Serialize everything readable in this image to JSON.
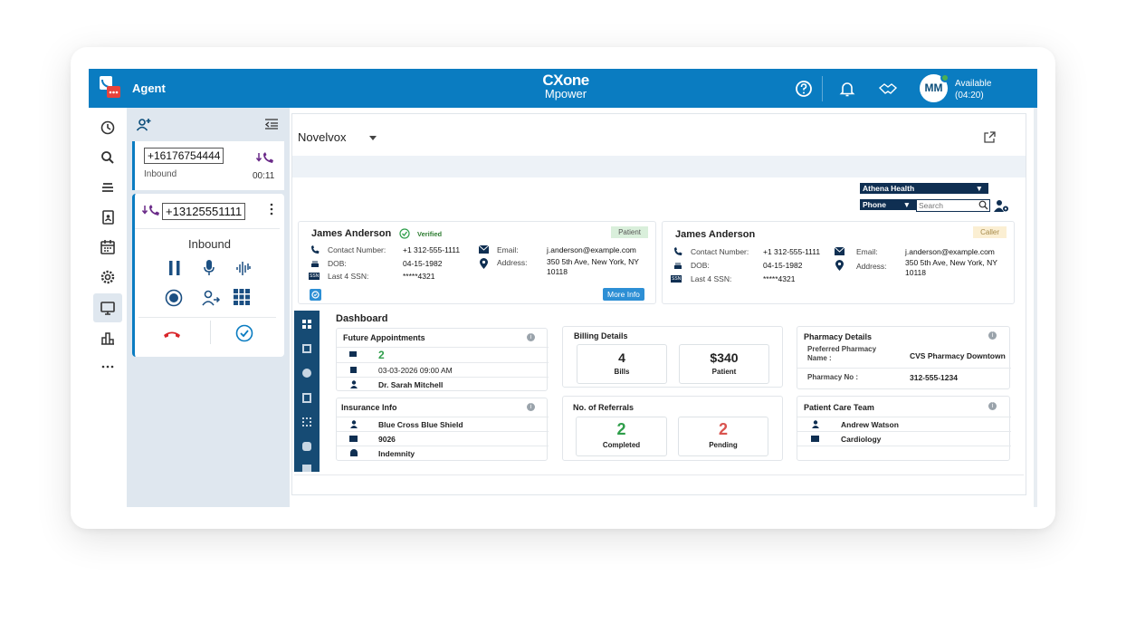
{
  "topbar": {
    "app_label": "Agent",
    "brand_line1": "CXone",
    "brand_line2": "Mpower",
    "avatar_initials": "MM",
    "status": "Available",
    "status_timer": "(04:20)"
  },
  "panel": {
    "call1": {
      "number": "+16176754444",
      "direction": "Inbound",
      "timer": "00:11"
    },
    "call2": {
      "number": "+13125551111",
      "direction": "Inbound"
    }
  },
  "main": {
    "app_select": "Novelvox",
    "ehr_select": "Athena Health",
    "search_type": "Phone",
    "search_placeholder": "Search",
    "patient_card": {
      "name": "James Anderson",
      "verified": "Verified",
      "badge": "Patient",
      "contact_label": "Contact Number:",
      "contact": "+1 312-555-1111",
      "dob_label": "DOB:",
      "dob": "04-15-1982",
      "ssn_label": "Last 4 SSN:",
      "ssn": "*****4321",
      "email_label": "Email:",
      "email": "j.anderson@example.com",
      "address_label": "Address:",
      "address_line1": "350 5th Ave, New York, NY",
      "address_line2": "10118",
      "more_info": "More Info"
    },
    "caller_card": {
      "name": "James Anderson",
      "badge": "Caller",
      "contact_label": "Contact Number:",
      "contact": "+1 312-555-1111",
      "dob_label": "DOB:",
      "dob": "04-15-1982",
      "ssn_label": "Last 4 SSN:",
      "ssn": "*****4321",
      "email_label": "Email:",
      "email": "j.anderson@example.com",
      "address_label": "Address:",
      "address_line1": "350 5th Ave, New York, NY",
      "address_line2": "10118"
    },
    "dashboard": {
      "title": "Dashboard",
      "appointments": {
        "title": "Future Appointments",
        "count": "2",
        "datetime": "03-03-2026 09:00 AM",
        "doctor": "Dr. Sarah Mitchell"
      },
      "insurance": {
        "title": "Insurance Info",
        "provider": "Blue Cross Blue Shield",
        "id": "9026",
        "type": "Indemnity"
      },
      "billing": {
        "title": "Billing Details",
        "bills_value": "4",
        "bills_label": "Bills",
        "patient_value": "$340",
        "patient_label": "Patient"
      },
      "referrals": {
        "title": "No. of Referrals",
        "completed_value": "2",
        "completed_label": "Completed",
        "pending_value": "2",
        "pending_label": "Pending"
      },
      "pharmacy": {
        "title": "Pharmacy Details",
        "preferred_label": "Preferred Pharmacy Name :",
        "preferred": "CVS Pharmacy Downtown",
        "no_label": "Pharmacy No :",
        "no": "312-555-1234"
      },
      "care_team": {
        "title": "Patient Care Team",
        "doctor": "Andrew Watson",
        "dept": "Cardiology"
      }
    }
  },
  "colors": {
    "brand": "#0a7cc1",
    "dark_navy": "#164b74",
    "green": "#2e9e4a",
    "red": "#d9534f"
  }
}
